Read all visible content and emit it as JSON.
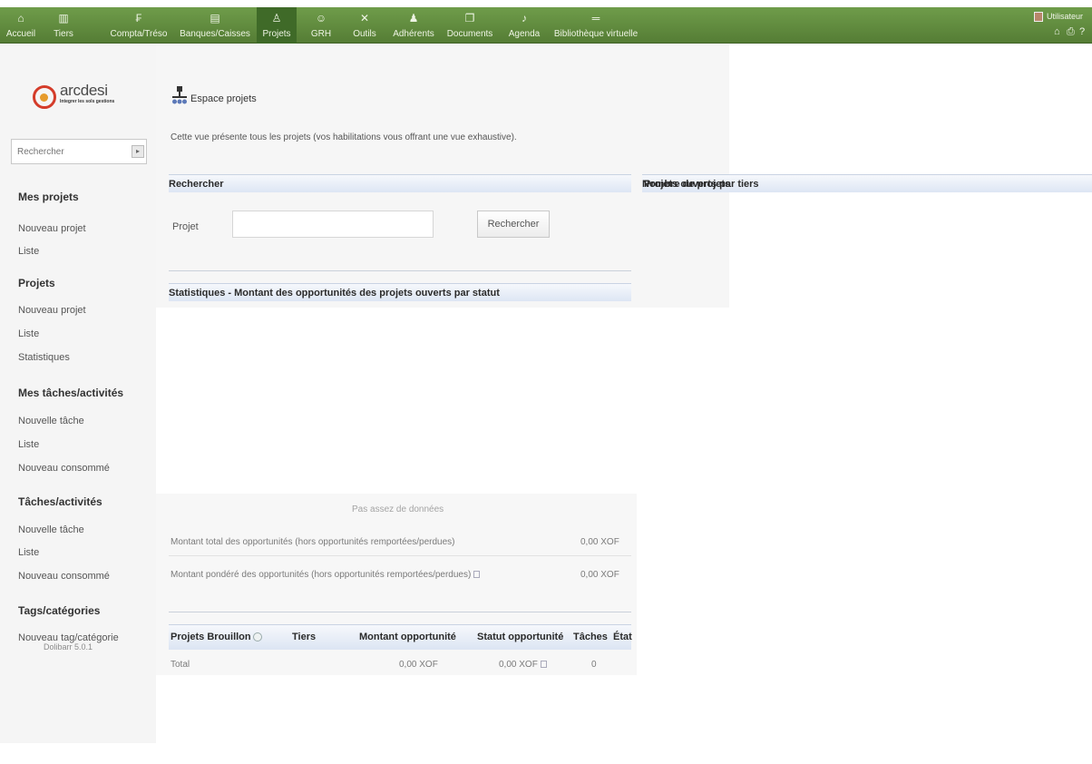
{
  "menu": {
    "items": [
      {
        "label": "Accueil",
        "icon": "home-icon"
      },
      {
        "label": "Tiers",
        "icon": "building-icon"
      },
      {
        "label": "Compta/Tréso",
        "icon": "coins-icon"
      },
      {
        "label": "Banques/Caisses",
        "icon": "bank-icon"
      },
      {
        "label": "Projets",
        "icon": "project-icon"
      },
      {
        "label": "GRH",
        "icon": "people-icon"
      },
      {
        "label": "Outils",
        "icon": "tools-icon"
      },
      {
        "label": "Adhérents",
        "icon": "members-icon"
      },
      {
        "label": "Documents",
        "icon": "documents-icon"
      },
      {
        "label": "Agenda",
        "icon": "calendar-icon"
      },
      {
        "label": "Bibliothèque virtuelle",
        "icon": "library-icon"
      }
    ],
    "active_label": "Projets"
  },
  "user": {
    "name": "Utilisateur",
    "icons": [
      "home-icon",
      "print-icon",
      "help-icon"
    ]
  },
  "logo": {
    "brand": "arcdesi",
    "tagline": "Integrer les sols gestions"
  },
  "sidebar": {
    "search_placeholder": "Rechercher",
    "sections": [
      {
        "title": "Mes projets",
        "links": [
          "Nouveau projet",
          "Liste"
        ]
      },
      {
        "title": "Projets",
        "links": [
          "Nouveau projet",
          "Liste",
          "Statistiques"
        ]
      },
      {
        "title": "Mes tâches/activités",
        "links": [
          "Nouvelle tâche",
          "Liste",
          "Nouveau consommé"
        ]
      },
      {
        "title": "Tâches/activités",
        "links": [
          "Nouvelle tâche",
          "Liste",
          "Nouveau consommé"
        ]
      },
      {
        "title": "Tags/catégories",
        "links": [
          "Nouveau tag/catégorie"
        ]
      }
    ],
    "version": "Dolibarr 5.0.1"
  },
  "page": {
    "title": "Espace projets",
    "description": "Cette vue présente tous les projets (vos habilitations vous offrant une vue exhaustive)."
  },
  "search_section": {
    "title": "Rechercher",
    "project_label": "Projet",
    "project_value": "",
    "button_label": "Rechercher"
  },
  "open_by_thirdparty": {
    "title": "Projets ouverts par tiers",
    "count_header": "Nombre de projets"
  },
  "statistics": {
    "title": "Statistiques - Montant des opportunités des projets ouverts par statut",
    "no_data": "Pas assez de données",
    "rows": [
      {
        "label": "Montant total des opportunités (hors opportunités remportées/perdues)",
        "value": "0,00 XOF"
      },
      {
        "label": "Montant pondéré des opportunités (hors opportunités remportées/perdues)",
        "value": "0,00 XOF"
      }
    ]
  },
  "draft_table": {
    "headers": [
      "Projets Brouillon",
      "Tiers",
      "Montant opportunité",
      "Statut opportunité",
      "Tâches",
      "État"
    ],
    "total_row": {
      "label": "Total",
      "amount": "0,00 XOF",
      "status_amount": "0,00 XOF",
      "tasks": "0"
    }
  }
}
